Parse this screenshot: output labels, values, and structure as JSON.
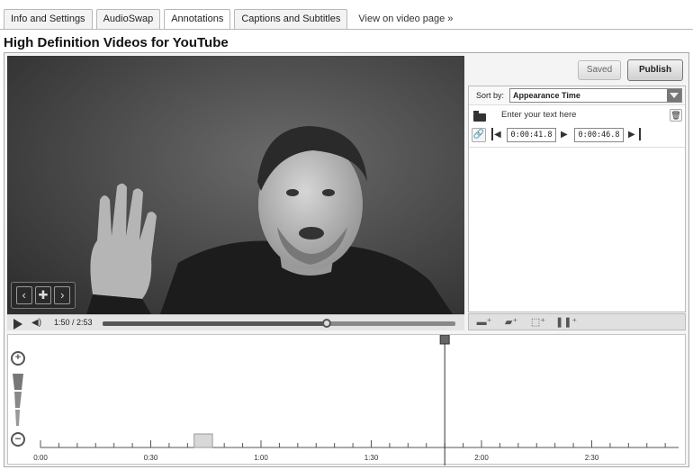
{
  "tabs": [
    {
      "label": "Info and Settings"
    },
    {
      "label": "AudioSwap"
    },
    {
      "label": "Annotations"
    },
    {
      "label": "Captions and Subtitles"
    }
  ],
  "view_link": "View on video page »",
  "page_title": "High Definition Videos for YouTube",
  "player": {
    "time": "1:50 / 2:53",
    "progress": 0.636
  },
  "actions": {
    "saved": "Saved",
    "publish": "Publish"
  },
  "annotations_panel": {
    "sort_label": "Sort by:",
    "sort_value": "Appearance Time",
    "item": {
      "text": "Enter your text here",
      "start": "0:00:41.8",
      "end": "0:00:46.8"
    }
  },
  "timeline": {
    "labels": [
      "0:00",
      "0:30",
      "1:00",
      "1:30",
      "2:00",
      "2:30"
    ],
    "playhead_seconds": 110,
    "annotation_start_seconds": 41.8,
    "annotation_end_seconds": 46.8
  },
  "colors": {
    "accent": "#555555",
    "panel": "#f4f4f4"
  }
}
